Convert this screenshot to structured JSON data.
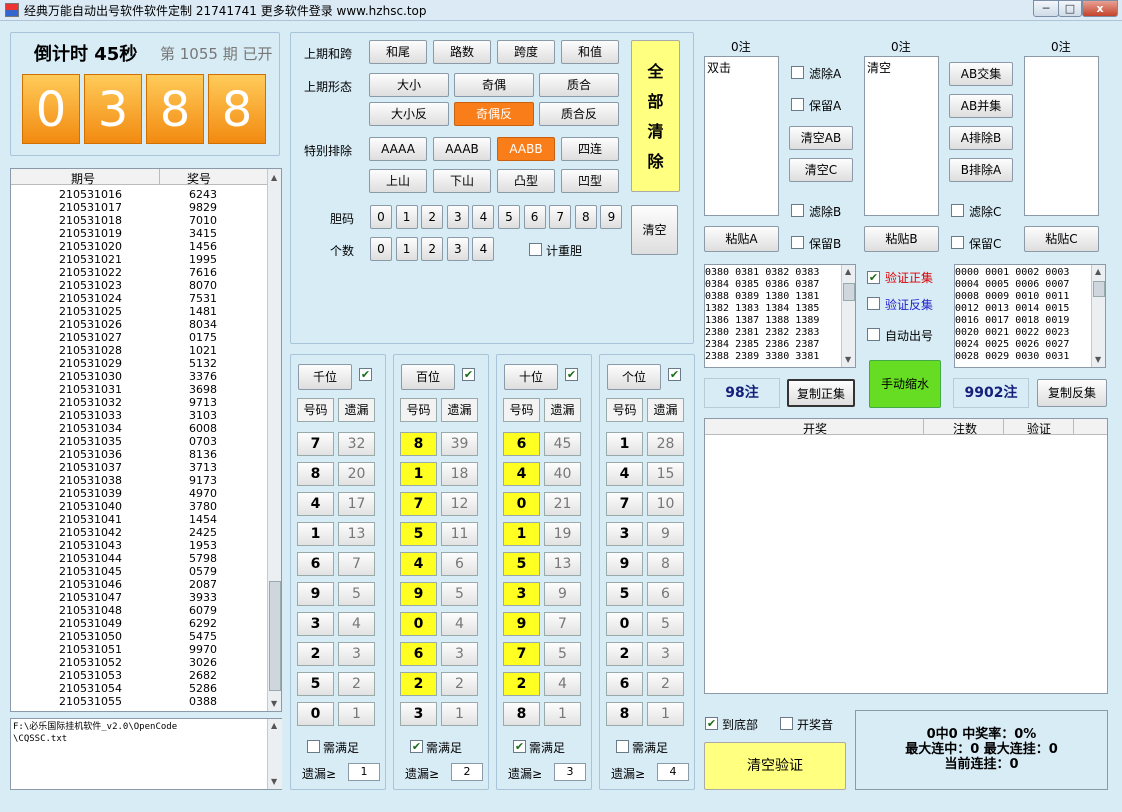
{
  "window": {
    "title": "经典万能自动出号软件软件定制 21741741 更多软件登录 www.hzhsc.top",
    "min": "─",
    "max": "□",
    "close": "x"
  },
  "timer": {
    "countdown": "倒计时 45秒",
    "period": "第 1055 期 已开",
    "digits": [
      "0",
      "3",
      "8",
      "8"
    ]
  },
  "history": {
    "col_period": "期号",
    "col_number": "奖号",
    "rows": [
      [
        "210531016",
        "6243"
      ],
      [
        "210531017",
        "9829"
      ],
      [
        "210531018",
        "7010"
      ],
      [
        "210531019",
        "3415"
      ],
      [
        "210531020",
        "1456"
      ],
      [
        "210531021",
        "1995"
      ],
      [
        "210531022",
        "7616"
      ],
      [
        "210531023",
        "8070"
      ],
      [
        "210531024",
        "7531"
      ],
      [
        "210531025",
        "1481"
      ],
      [
        "210531026",
        "8034"
      ],
      [
        "210531027",
        "0175"
      ],
      [
        "210531028",
        "1021"
      ],
      [
        "210531029",
        "5132"
      ],
      [
        "210531030",
        "3376"
      ],
      [
        "210531031",
        "3698"
      ],
      [
        "210531032",
        "9713"
      ],
      [
        "210531033",
        "3103"
      ],
      [
        "210531034",
        "6008"
      ],
      [
        "210531035",
        "0703"
      ],
      [
        "210531036",
        "8136"
      ],
      [
        "210531037",
        "3713"
      ],
      [
        "210531038",
        "9173"
      ],
      [
        "210531039",
        "4970"
      ],
      [
        "210531040",
        "3780"
      ],
      [
        "210531041",
        "1454"
      ],
      [
        "210531042",
        "2425"
      ],
      [
        "210531043",
        "1953"
      ],
      [
        "210531044",
        "5798"
      ],
      [
        "210531045",
        "0579"
      ],
      [
        "210531046",
        "2087"
      ],
      [
        "210531047",
        "3933"
      ],
      [
        "210531048",
        "6079"
      ],
      [
        "210531049",
        "6292"
      ],
      [
        "210531050",
        "5475"
      ],
      [
        "210531051",
        "9970"
      ],
      [
        "210531052",
        "3026"
      ],
      [
        "210531053",
        "2682"
      ],
      [
        "210531054",
        "5286"
      ],
      [
        "210531055",
        "0388"
      ]
    ]
  },
  "path_text": "F:\\必乐国际挂机软件_v2.0\\OpenCode\n\\CQSSC.txt",
  "filters": {
    "row1_label": "上期和跨",
    "row1": [
      "和尾",
      "路数",
      "跨度",
      "和值"
    ],
    "row2_label": "上期形态",
    "row2a": [
      "大小",
      "奇偶",
      "质合"
    ],
    "row2b": [
      "大小反",
      "奇偶反",
      "质合反"
    ],
    "row3_label": "特别排除",
    "row3a": [
      "AAAA",
      "AAAB",
      "AABB",
      "四连"
    ],
    "row3b": [
      "上山",
      "下山",
      "凸型",
      "凹型"
    ],
    "dan_label": "胆码",
    "dan": [
      "0",
      "1",
      "2",
      "3",
      "4",
      "5",
      "6",
      "7",
      "8",
      "9"
    ],
    "count_label": "个数",
    "count": [
      "0",
      "1",
      "2",
      "3",
      "4"
    ],
    "count_repeat": "计重胆",
    "clear": "清空",
    "clear_all": [
      "全",
      "部",
      "清",
      "除"
    ]
  },
  "positions": [
    {
      "name": "千位",
      "need": "需满足",
      "miss_label": "遗漏≥",
      "miss": "1",
      "needed": false,
      "rows": [
        [
          "7",
          "32"
        ],
        [
          "8",
          "20"
        ],
        [
          "4",
          "17"
        ],
        [
          "1",
          "13"
        ],
        [
          "6",
          "7"
        ],
        [
          "9",
          "5"
        ],
        [
          "3",
          "4"
        ],
        [
          "2",
          "3"
        ],
        [
          "5",
          "2"
        ],
        [
          "0",
          "1"
        ]
      ],
      "hl": []
    },
    {
      "name": "百位",
      "need": "需满足",
      "miss_label": "遗漏≥",
      "miss": "2",
      "needed": true,
      "rows": [
        [
          "8",
          "39"
        ],
        [
          "1",
          "18"
        ],
        [
          "7",
          "12"
        ],
        [
          "5",
          "11"
        ],
        [
          "4",
          "6"
        ],
        [
          "9",
          "5"
        ],
        [
          "0",
          "4"
        ],
        [
          "6",
          "3"
        ],
        [
          "2",
          "2"
        ],
        [
          "3",
          "1"
        ]
      ],
      "hl": [
        0,
        1,
        2,
        3,
        4,
        5,
        6,
        7,
        8
      ]
    },
    {
      "name": "十位",
      "need": "需满足",
      "miss_label": "遗漏≥",
      "miss": "3",
      "needed": true,
      "rows": [
        [
          "6",
          "45"
        ],
        [
          "4",
          "40"
        ],
        [
          "0",
          "21"
        ],
        [
          "1",
          "19"
        ],
        [
          "5",
          "13"
        ],
        [
          "3",
          "9"
        ],
        [
          "9",
          "7"
        ],
        [
          "7",
          "5"
        ],
        [
          "2",
          "4"
        ],
        [
          "8",
          "1"
        ]
      ],
      "hl": [
        0,
        1,
        2,
        3,
        4,
        5,
        6,
        7,
        8
      ]
    },
    {
      "name": "个位",
      "need": "需满足",
      "miss_label": "遗漏≥",
      "miss": "4",
      "needed": false,
      "rows": [
        [
          "1",
          "28"
        ],
        [
          "4",
          "15"
        ],
        [
          "7",
          "10"
        ],
        [
          "3",
          "9"
        ],
        [
          "9",
          "8"
        ],
        [
          "5",
          "6"
        ],
        [
          "0",
          "5"
        ],
        [
          "2",
          "3"
        ],
        [
          "6",
          "2"
        ],
        [
          "8",
          "1"
        ]
      ],
      "hl": []
    }
  ],
  "col_code": "号码",
  "col_miss": "遗漏",
  "sets": {
    "a_count": "0注",
    "b_count": "0注",
    "c_count": "0注",
    "a_text": "双击",
    "b_text": "清空",
    "filterA": "滤除A",
    "keepA": "保留A",
    "filterB": "滤除B",
    "keepB": "保留B",
    "filterC": "滤除C",
    "keepC": "保留C",
    "clearAB": "清空AB",
    "clearC": "清空C",
    "ab_inter": "AB交集",
    "ab_union": "AB并集",
    "a_excl": "A排除B",
    "b_excl": "B排除A",
    "pasteA": "粘贴A",
    "pasteB": "粘贴B",
    "pasteC": "粘贴C"
  },
  "result": {
    "pos_codes": "0380 0381 0382 0383\n0384 0385 0386 0387\n0388 0389 1380 1381\n1382 1383 1384 1385\n1386 1387 1388 1389\n2380 2381 2382 2383\n2384 2385 2386 2387\n2388 2389 3380 3381",
    "neg_codes": "0000 0001 0002 0003\n0004 0005 0006 0007\n0008 0009 0010 0011\n0012 0013 0014 0015\n0016 0017 0018 0019\n0020 0021 0022 0023\n0024 0025 0026 0027\n0028 0029 0030 0031",
    "verify_pos": "验证正集",
    "verify_neg": "验证反集",
    "auto": "自动出号",
    "pos_count": "98注",
    "neg_count": "9902注",
    "copy_pos": "复制正集",
    "copy_neg": "复制反集",
    "shrink": "手动缩水"
  },
  "verify": {
    "col1": "开奖",
    "col2": "注数",
    "col3": "验证",
    "bottom": "到底部",
    "sound": "开奖音",
    "clear": "清空验证",
    "line1": "0中0  中奖率：0%",
    "line2": "最大连中：0  最大连挂：0",
    "line3": "当前连挂：0"
  },
  "colors": {
    "accent": "#f97e1a",
    "highlight": "#ffff22",
    "shrink": "#66dd22",
    "clearall": "#ffff80"
  }
}
